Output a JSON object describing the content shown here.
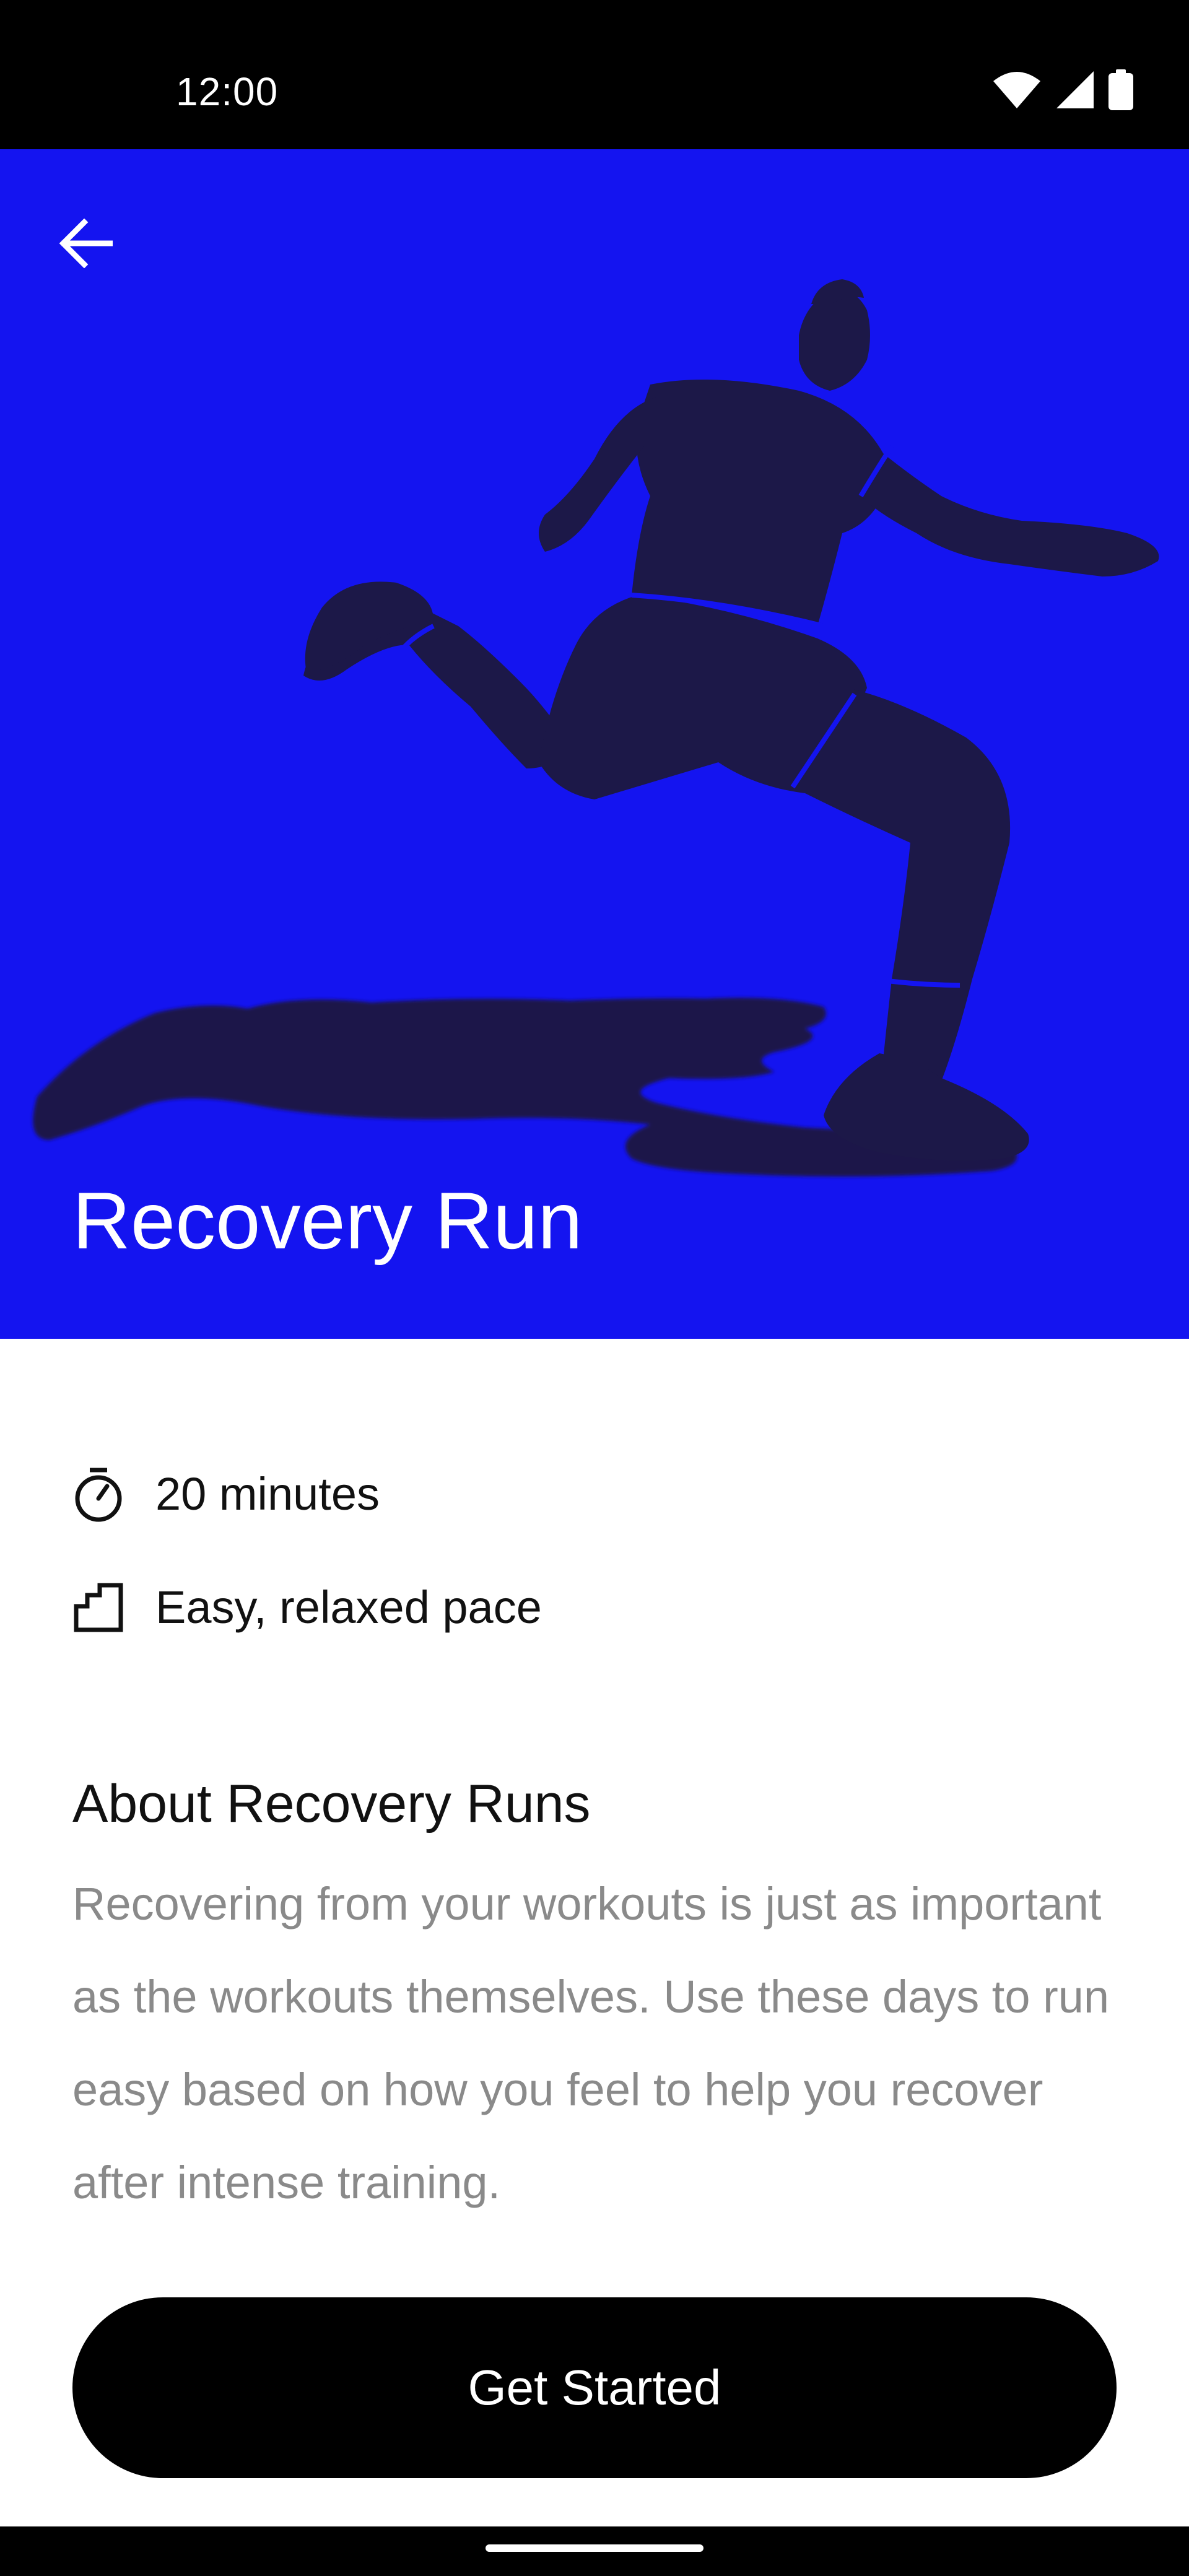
{
  "status_bar": {
    "time": "12:00",
    "icons": [
      "wifi-icon",
      "signal-icon",
      "battery-icon"
    ]
  },
  "hero": {
    "title": "Recovery Run",
    "background_color": "#1414f0",
    "back_icon": "arrow-left-icon",
    "illustration": "runner-illustration"
  },
  "details": [
    {
      "icon": "stopwatch-icon",
      "label": "20 minutes"
    },
    {
      "icon": "stairs-icon",
      "label": "Easy, relaxed pace"
    }
  ],
  "about": {
    "title": "About Recovery Runs",
    "body": "Recovering from your workouts is just as important as the workouts themselves. Use these days to run easy based on how you feel to help you recover after intense training."
  },
  "cta": {
    "label": "Get Started"
  }
}
